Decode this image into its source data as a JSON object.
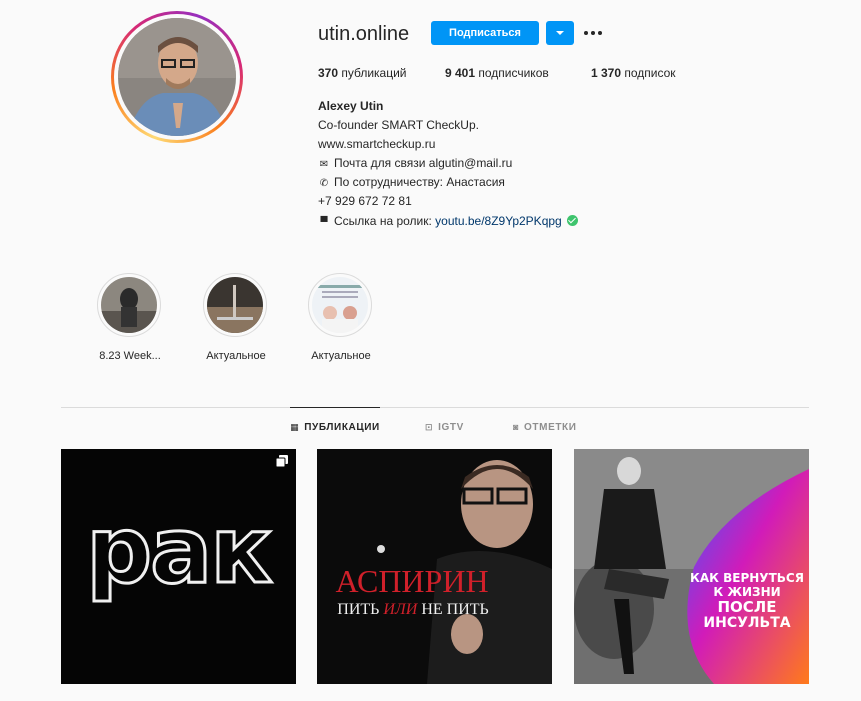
{
  "profile": {
    "username": "utin.online",
    "follow_label": "Подписаться",
    "stats": {
      "posts_count": "370",
      "posts_label": "публикаций",
      "followers_count": "9 401",
      "followers_label": "подписчиков",
      "following_count": "1 370",
      "following_label": "подписок"
    },
    "bio": {
      "name": "Alexey Utin",
      "line1": "Co-founder SMART CheckUp.",
      "line2": "www.smartcheckup.ru",
      "line3": "Почта для связи algutin@mail.ru",
      "line4": "По сотрудничеству: Анастасия",
      "line5": "+7 929 672 72 81",
      "line6_text": "Ссылка на ролик:",
      "line6_link": "youtu.be/8Z9Yp2PKqpg"
    }
  },
  "highlights": [
    {
      "label": "8.23 Week..."
    },
    {
      "label": "Актуальное"
    },
    {
      "label": "Актуальное"
    }
  ],
  "tabs": [
    {
      "label": "ПУБЛИКАЦИИ",
      "active": true
    },
    {
      "label": "IGTV",
      "active": false
    },
    {
      "label": "ОТМЕТКИ",
      "active": false
    }
  ],
  "posts": [
    {
      "text": "рак"
    },
    {
      "title": "АСПИРИН",
      "subtitle_a": "ПИТЬ",
      "subtitle_b": "ИЛИ",
      "subtitle_c": "НЕ ПИТЬ"
    },
    {
      "line1": "КАК ВЕРНУТЬСЯ",
      "line2": "К ЖИЗНИ",
      "line3": "ПОСЛЕ",
      "line4": "ИНСУЛЬТА"
    }
  ],
  "colors": {
    "accent": "#0095f6",
    "link": "#00376b",
    "verified": "#3ec46d"
  }
}
